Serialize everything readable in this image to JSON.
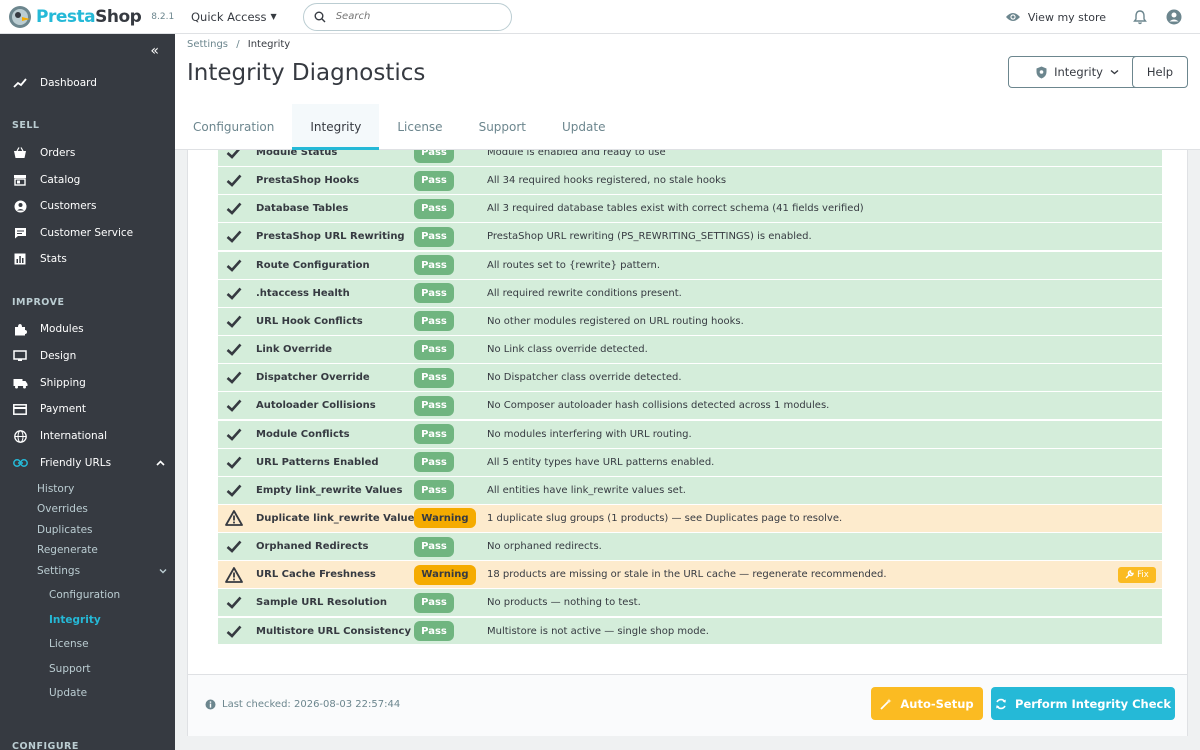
{
  "header": {
    "logo_text_a": "Presta",
    "logo_text_b": "Shop",
    "version": "8.2.1",
    "quick_access": "Quick Access",
    "search_placeholder": "Search",
    "view_store": "View my store"
  },
  "sidebar": {
    "dashboard": "Dashboard",
    "sell_section": "SELL",
    "sell_items": [
      "Orders",
      "Catalog",
      "Customers",
      "Customer Service",
      "Stats"
    ],
    "improve_section": "IMPROVE",
    "improve_items": [
      "Modules",
      "Design",
      "Shipping",
      "Payment",
      "International",
      "Friendly URLs"
    ],
    "friendly_sub": [
      "History",
      "Overrides",
      "Duplicates",
      "Regenerate",
      "Settings"
    ],
    "settings_sub": [
      "Configuration",
      "Integrity",
      "License",
      "Support",
      "Update"
    ],
    "configure_section": "CONFIGURE"
  },
  "page": {
    "breadcrumb_parent": "Settings",
    "breadcrumb_sep": "/",
    "breadcrumb_current": "Integrity",
    "title": "Integrity Diagnostics",
    "integrity_button": "Integrity",
    "help_button": "Help",
    "tabs": [
      "Configuration",
      "Integrity",
      "License",
      "Support",
      "Update"
    ]
  },
  "checks": [
    {
      "name": "Module Status",
      "status": "Pass",
      "message": "Module is enabled and ready to use"
    },
    {
      "name": "PrestaShop Hooks",
      "status": "Pass",
      "message": "All 34 required hooks registered, no stale hooks"
    },
    {
      "name": "Database Tables",
      "status": "Pass",
      "message": "All 3 required database tables exist with correct schema (41 fields verified)"
    },
    {
      "name": "PrestaShop URL Rewriting",
      "status": "Pass",
      "message": "PrestaShop URL rewriting (PS_REWRITING_SETTINGS) is enabled."
    },
    {
      "name": "Route Configuration",
      "status": "Pass",
      "message": "All routes set to {rewrite} pattern."
    },
    {
      "name": ".htaccess Health",
      "status": "Pass",
      "message": "All required rewrite conditions present."
    },
    {
      "name": "URL Hook Conflicts",
      "status": "Pass",
      "message": "No other modules registered on URL routing hooks."
    },
    {
      "name": "Link Override",
      "status": "Pass",
      "message": "No Link class override detected."
    },
    {
      "name": "Dispatcher Override",
      "status": "Pass",
      "message": "No Dispatcher class override detected."
    },
    {
      "name": "Autoloader Collisions",
      "status": "Pass",
      "message": "No Composer autoloader hash collisions detected across 1 modules."
    },
    {
      "name": "Module Conflicts",
      "status": "Pass",
      "message": "No modules interfering with URL routing."
    },
    {
      "name": "URL Patterns Enabled",
      "status": "Pass",
      "message": "All 5 entity types have URL patterns enabled."
    },
    {
      "name": "Empty link_rewrite Values",
      "status": "Pass",
      "message": "All entities have link_rewrite values set."
    },
    {
      "name": "Duplicate link_rewrite Values",
      "status": "Warning",
      "message": "1 duplicate slug groups (1 products) — see Duplicates page to resolve."
    },
    {
      "name": "Orphaned Redirects",
      "status": "Pass",
      "message": "No orphaned redirects."
    },
    {
      "name": "URL Cache Freshness",
      "status": "Warning",
      "message": "18 products are missing or stale in the URL cache — regenerate recommended.",
      "fix": "Fix"
    },
    {
      "name": "Sample URL Resolution",
      "status": "Pass",
      "message": "No products — nothing to test."
    },
    {
      "name": "Multistore URL Consistency",
      "status": "Pass",
      "message": "Multistore is not active — single shop mode."
    }
  ],
  "footer": {
    "last_checked": "Last checked: 2026-08-03 22:57:44",
    "auto_setup": "Auto-Setup",
    "perform_check": "Perform Integrity Check"
  },
  "colors": {
    "accent": "#25b9d7",
    "pass_bg": "#d4edda",
    "warn_bg": "#fdebcd",
    "pass_badge": "#70b580",
    "warn_badge": "#f5ab00",
    "sidebar_bg": "#363a41"
  }
}
